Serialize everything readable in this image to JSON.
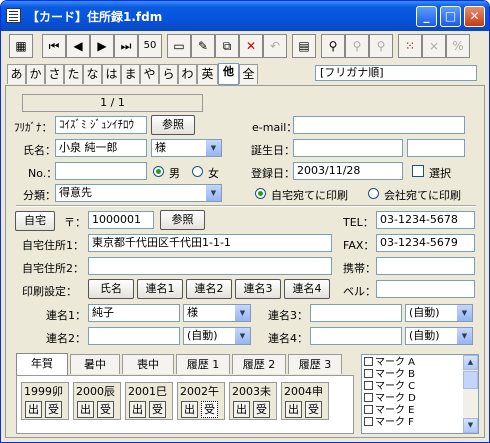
{
  "window": {
    "title": "【カード】住所録1.fdm"
  },
  "toolbar": {
    "zoom_label": "50"
  },
  "kana_tabs": [
    "あ",
    "か",
    "さ",
    "た",
    "な",
    "は",
    "ま",
    "や",
    "ら",
    "わ",
    "英",
    "他",
    "全"
  ],
  "sort_label": "[フリガナ順]",
  "record": {
    "counter": "1 / 1"
  },
  "person": {
    "furigana_label": "ﾌﾘｶﾞﾅ：",
    "furigana": "ｺｲｽﾞﾐ ｼﾞｭﾝｲﾁﾛｳ",
    "ref_button": "参照",
    "name_label": "氏名：",
    "name": "小泉 純一郎",
    "honorific": "様",
    "no_label": "No.：",
    "no": "",
    "gender_male": "男",
    "gender_female": "女",
    "category_label": "分類：",
    "category": "得意先",
    "email_label": "e-mail：",
    "email": "",
    "birthday_label": "誕生日：",
    "birthday": "",
    "regdate_label": "登録日：",
    "regdate": "2003/11/28",
    "select_label": "選択"
  },
  "print_to": {
    "home": "自宅宛てに印刷",
    "office": "会社宛てに印刷"
  },
  "address": {
    "home_button": "自宅",
    "zip_mark": "〒：",
    "zip": "1000001",
    "ref_button": "参照",
    "addr1_label": "自宅住所1：",
    "addr1": "東京都千代田区千代田1-1-1",
    "addr2_label": "自宅住所2：",
    "addr2": "",
    "tel_label": "TEL：",
    "tel": "03-1234-5678",
    "fax_label": "FAX：",
    "fax": "03-1234-5679",
    "mobile_label": "携帯：",
    "mobile": "",
    "bell_label": "ベル：",
    "bell": ""
  },
  "print_setting": {
    "label": "印刷設定：",
    "buttons": [
      "氏名",
      "連名1",
      "連名2",
      "連名3",
      "連名4"
    ]
  },
  "joint": {
    "r1_label": "連名1：",
    "r1": "純子",
    "r1_hon": "様",
    "r2_label": "連名2：",
    "r2": "",
    "r2_hon": "(自動)",
    "r3_label": "連名3：",
    "r3": "",
    "r3_hon": "(自動)",
    "r4_label": "連名4：",
    "r4": "",
    "r4_hon": "(自動)"
  },
  "bottom_tabs": [
    "年賀",
    "暑中",
    "喪中",
    "履歴 1",
    "履歴 2",
    "履歴 3"
  ],
  "years": [
    {
      "label": "1999卯",
      "out": "出",
      "recv": "受"
    },
    {
      "label": "2000辰",
      "out": "出",
      "recv": "受"
    },
    {
      "label": "2001巳",
      "out": "出",
      "recv": "受"
    },
    {
      "label": "2002午",
      "out": "出",
      "recv": "受"
    },
    {
      "label": "2003未",
      "out": "出",
      "recv": "受"
    },
    {
      "label": "2004申",
      "out": "出",
      "recv": "受"
    }
  ],
  "marks": [
    "マーク A",
    "マーク B",
    "マーク C",
    "マーク D",
    "マーク E",
    "マーク F"
  ]
}
